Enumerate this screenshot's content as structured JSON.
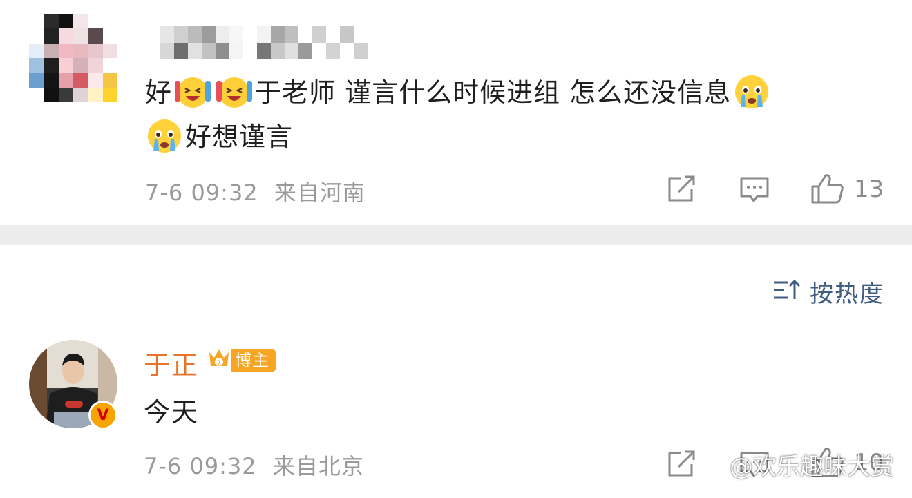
{
  "comment1": {
    "text_line1_prefix": "好",
    "text_line1_main": "于老师 谨言什么时候进组 怎么还没信息",
    "text_line2": "好想谨言",
    "timestamp": "7-6 09:32",
    "location": "来自河南",
    "like_count": "13",
    "emoji_names": [
      "laugh-cry-emoji",
      "laugh-cry-emoji",
      "crying-emoji",
      "crying-emoji"
    ]
  },
  "sort": {
    "label": "按热度"
  },
  "comment2": {
    "author": "于正",
    "badge_label": "博主",
    "text": "今天",
    "timestamp": "7-6 09:32",
    "location": "来自北京",
    "like_count": "10"
  },
  "watermark": {
    "text": "@欢乐趣味大赏"
  },
  "colors": {
    "author": "#e8742c",
    "sort_label": "#3f5c82",
    "meta": "#9a9a9a",
    "divider": "#ececec",
    "badge": "#f6a623"
  }
}
